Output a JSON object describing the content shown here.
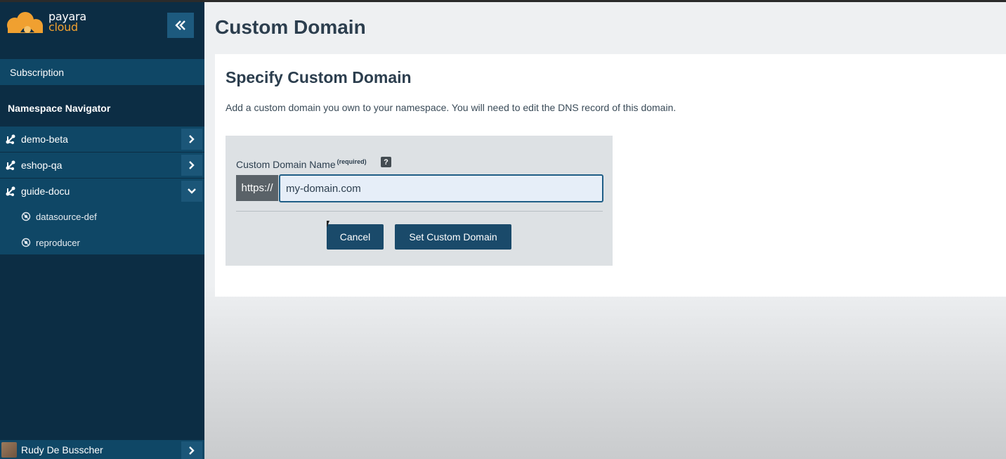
{
  "brand": {
    "line1": "payara",
    "line2": "cloud"
  },
  "sidebar": {
    "collapse_icon": "double-chevron-left-icon",
    "subscription_label": "Subscription",
    "namespace_title": "Namespace Navigator",
    "namespaces": [
      {
        "label": "demo-beta",
        "icon": "namespace-icon",
        "expanded": false
      },
      {
        "label": "eshop-qa",
        "icon": "namespace-icon",
        "expanded": false
      },
      {
        "label": "guide-docu",
        "icon": "namespace-icon",
        "expanded": true
      }
    ],
    "sub_items": [
      {
        "label": "datasource-def",
        "icon": "application-icon"
      },
      {
        "label": "reproducer",
        "icon": "application-icon"
      }
    ],
    "user": {
      "name": "Rudy De Busscher"
    }
  },
  "main": {
    "title": "Custom Domain",
    "panel": {
      "title": "Specify Custom Domain",
      "description": "Add a custom domain you own to your namespace. You will need to edit the DNS record of this domain.",
      "field_label": "Custom Domain Name",
      "field_required": "(required)",
      "help_icon": "?",
      "prefix": "https://",
      "input_value": "my-domain.com",
      "cancel_label": "Cancel",
      "submit_label": "Set Custom Domain"
    }
  },
  "colors": {
    "sidebar_bg": "#0c2d44",
    "sidebar_item_bg": "#0f4766",
    "accent": "#1a4a6a",
    "brand_orange": "#f0a030"
  }
}
